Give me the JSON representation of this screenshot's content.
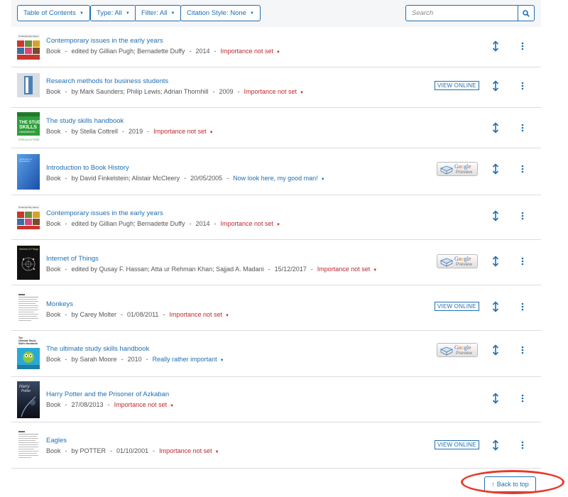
{
  "toolbar": {
    "toc_label": "Table of Contents",
    "type_label": "Type: All",
    "filter_label": "Filter: All",
    "citation_label": "Citation Style: None",
    "search_placeholder": "Search"
  },
  "colors": {
    "accent": "#1f6fb2",
    "importance_unset": "#c0282d",
    "annotation": "#e83a2a"
  },
  "items": [
    {
      "title": "Contemporary issues in the early years",
      "type": "Book",
      "authors": "edited by Gillian Pugh; Bernadette Duffy",
      "date": "2014",
      "importance": "Importance not set",
      "action": "none",
      "cover": "contemporary"
    },
    {
      "title": "Research methods for business students",
      "type": "Book",
      "authors": "by Mark Saunders; Philip Lewis; Adrian Thornhill",
      "date": "2009",
      "importance": "Importance not set",
      "action": "view_online",
      "cover": "research"
    },
    {
      "title": "The study skills handbook",
      "type": "Book",
      "authors": "by Stella Cottrell",
      "date": "2019",
      "importance": "Importance not set",
      "action": "none",
      "cover": "studyskills"
    },
    {
      "title": "Introduction to Book History",
      "type": "Book",
      "authors": "by David Finkelstein; Alistair McCleery",
      "date": "20/05/2005",
      "importance": "Now look here, my good man!",
      "action": "google_preview",
      "cover": "bookhistory"
    },
    {
      "title": "Contemporary issues in the early years",
      "type": "Book",
      "authors": "edited by Gillian Pugh; Bernadette Duffy",
      "date": "2014",
      "importance": "Importance not set",
      "action": "none",
      "cover": "contemporary"
    },
    {
      "title": "Internet of Things",
      "type": "Book",
      "authors": "edited by Qusay F. Hassan; Atta ur Rehman Khan; Sajjad A. Madani",
      "date": "15/12/2017",
      "importance": "Importance not set",
      "action": "google_preview",
      "cover": "iot"
    },
    {
      "title": "Monkeys",
      "type": "Book",
      "authors": "by Carey Molter",
      "date": "01/08/2011",
      "importance": "Importance not set",
      "action": "view_online",
      "cover": "document"
    },
    {
      "title": "The ultimate study skills handbook",
      "type": "Book",
      "authors": "by Sarah Moore",
      "date": "2010",
      "importance": "Really rather important",
      "action": "google_preview",
      "cover": "ultimate"
    },
    {
      "title": "Harry Potter and the Prisoner of Azkaban",
      "type": "Book",
      "date": "27/08/2013",
      "importance": "Importance not set",
      "action": "none",
      "cover": "potter"
    },
    {
      "title": "Eagles",
      "type": "Book",
      "authors": "by POTTER",
      "date": "01/10/2001",
      "importance": "Importance not set",
      "action": "view_online",
      "cover": "document"
    }
  ],
  "view_online_label": "VIEW ONLINE",
  "google_preview": {
    "line1": "Google",
    "line2": "Preview"
  },
  "back_to_top_label": "Back to top",
  "icons": {
    "search": "search-icon",
    "reorder": "reorder-arrows-icon",
    "more": "kebab-menu-icon",
    "back_to_top": "arrow-up-icon",
    "google_preview": "google-preview-book-icon"
  }
}
